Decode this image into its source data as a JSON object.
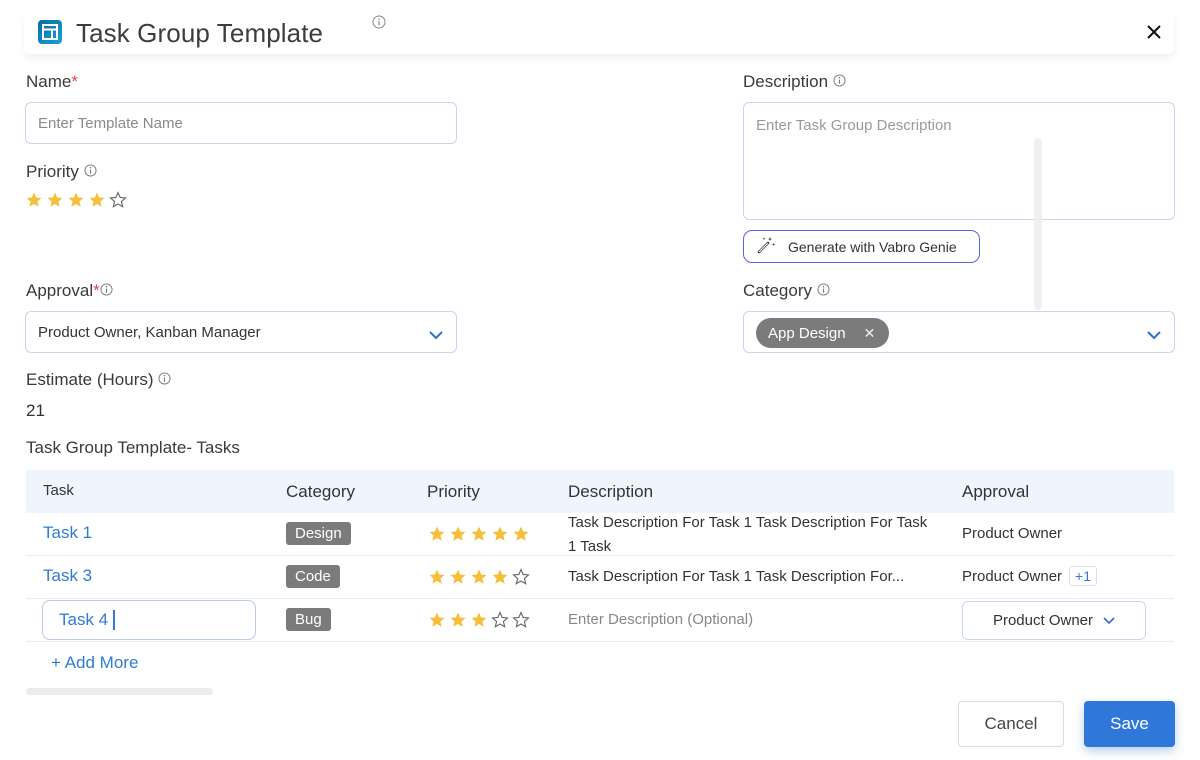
{
  "header": {
    "title": "Task Group Template",
    "icon": "template-layout-icon",
    "close_icon": "close-icon"
  },
  "form": {
    "name": {
      "label": "Name",
      "required_mark": "*",
      "placeholder": "Enter Template Name",
      "value": ""
    },
    "priority": {
      "label": "Priority",
      "rating": 4,
      "max": 5
    },
    "description": {
      "label": "Description",
      "placeholder": "Enter Task Group Description",
      "value": ""
    },
    "genie_button": {
      "label": "Generate with Vabro Genie",
      "icon": "magic-wand-icon"
    },
    "approval": {
      "label": "Approval",
      "required_mark": "*",
      "value": "Product Owner, Kanban Manager"
    },
    "category": {
      "label": "Category",
      "chips": [
        "App Design"
      ]
    },
    "estimate": {
      "label": "Estimate (Hours)",
      "value": "21"
    }
  },
  "tasks_section": {
    "title": "Task Group Template- Tasks",
    "columns": [
      "Task",
      "Category",
      "Priority",
      "Description",
      "Approval"
    ],
    "rows": [
      {
        "task": "Task 1",
        "category": "Design",
        "priority": 5,
        "description": "Task Description For Task 1 Task Description For Task 1 Task",
        "approval": "Product Owner",
        "approval_extra": ""
      },
      {
        "task": "Task 3",
        "category": "Code",
        "priority": 4,
        "description": "Task Description For Task 1 Task Description For...",
        "approval": "Product Owner",
        "approval_extra": "+1"
      },
      {
        "task": "Task 4",
        "category": "Bug",
        "priority": 3,
        "description_placeholder": "Enter Description (Optional)",
        "approval": "Product Owner",
        "editing": true
      }
    ],
    "add_more_label": "+ Add More"
  },
  "footer": {
    "cancel_label": "Cancel",
    "save_label": "Save"
  },
  "colors": {
    "accent": "#2f77d8",
    "link": "#2f7bd6",
    "star_filled": "#f5bf3c",
    "badge_bg": "#7b7b7b",
    "required": "#e0464a",
    "table_header_bg": "#eef5fd"
  }
}
